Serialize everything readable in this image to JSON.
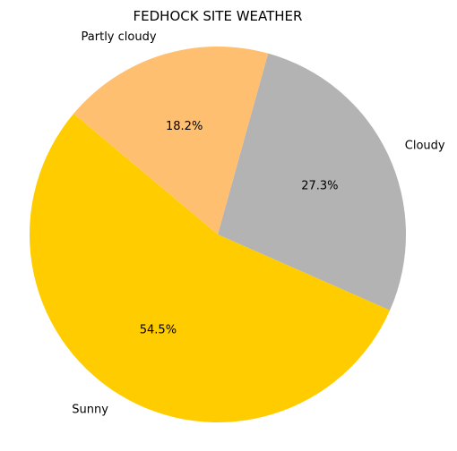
{
  "chart_data": {
    "type": "pie",
    "title": "FEDHOCK SITE WEATHER",
    "categories": [
      "Sunny",
      "Cloudy",
      "Partly cloudy"
    ],
    "values": [
      54.5,
      27.3,
      18.2
    ],
    "percent_labels": [
      "54.5%",
      "27.3%",
      "18.2%"
    ],
    "colors": [
      "#ffcc00",
      "#b3b3b3",
      "#ffbf70"
    ],
    "start_angle_degrees": 140,
    "direction": "counterclockwise",
    "legend": "none"
  }
}
